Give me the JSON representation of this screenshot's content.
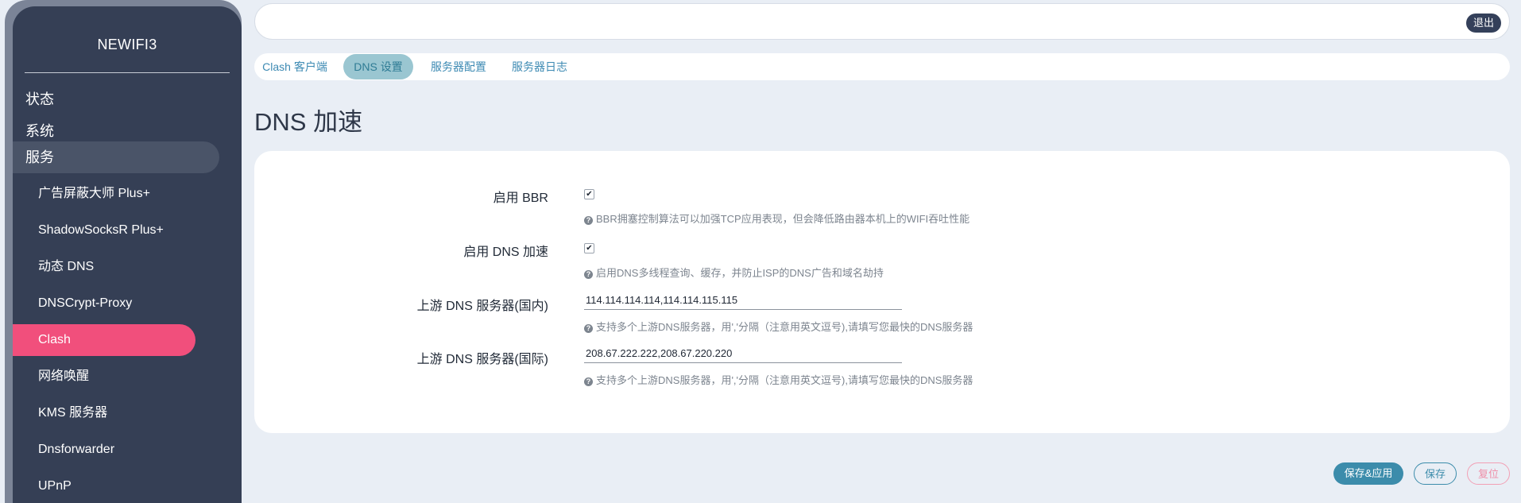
{
  "sidebar": {
    "brand": "NEWIFI3",
    "top_items": [
      {
        "label": "状态"
      },
      {
        "label": "系统"
      },
      {
        "label": "服务"
      }
    ],
    "sub_items": [
      {
        "label": "广告屏蔽大师 Plus+"
      },
      {
        "label": "ShadowSocksR Plus+"
      },
      {
        "label": "动态 DNS"
      },
      {
        "label": "DNSCrypt-Proxy"
      },
      {
        "label": "Clash"
      },
      {
        "label": "网络唤醒"
      },
      {
        "label": "KMS 服务器"
      },
      {
        "label": "Dnsforwarder"
      },
      {
        "label": "UPnP"
      }
    ]
  },
  "header": {
    "logout_label": "退出"
  },
  "tabs": [
    {
      "label": "Clash 客户端"
    },
    {
      "label": "DNS 设置"
    },
    {
      "label": "服务器配置"
    },
    {
      "label": "服务器日志"
    }
  ],
  "page": {
    "title": "DNS 加速"
  },
  "form": {
    "bbr": {
      "label": "启用 BBR",
      "checked": true,
      "help": "BBR拥塞控制算法可以加强TCP应用表现，但会降低路由器本机上的WIFI吞吐性能"
    },
    "dns_accel": {
      "label": "启用 DNS 加速",
      "checked": true,
      "help": "启用DNS多线程查询、缓存，并防止ISP的DNS广告和域名劫持"
    },
    "upstream_cn": {
      "label": "上游 DNS 服务器(国内)",
      "value": "114.114.114.114,114.114.115.115",
      "help": "支持多个上游DNS服务器，用','分隔（注意用英文逗号),请填写您最快的DNS服务器"
    },
    "upstream_intl": {
      "label": "上游 DNS 服务器(国际)",
      "value": "208.67.222.222,208.67.220.220",
      "help": "支持多个上游DNS服务器，用','分隔（注意用英文逗号),请填写您最快的DNS服务器"
    }
  },
  "footer": {
    "save_apply_label": "保存&应用",
    "save_label": "保存",
    "reset_label": "复位"
  },
  "colors": {
    "sidebar_bg": "#353f55",
    "active_sub": "#f14f7c",
    "accent": "#3c8cab",
    "page_bg": "#e9eef5"
  }
}
